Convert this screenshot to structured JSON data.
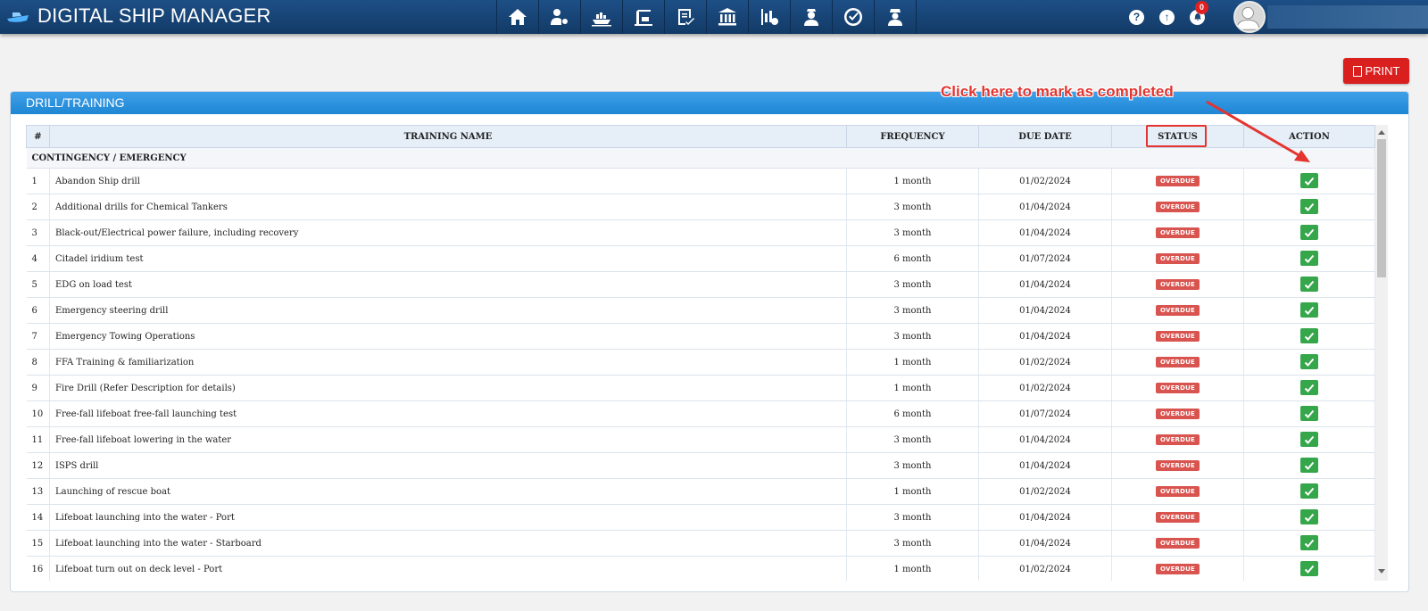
{
  "app": {
    "title": "DIGITAL SHIP MANAGER",
    "nav_icons": [
      "home-icon",
      "user-settings-icon",
      "ship-icon",
      "port-crane-icon",
      "certificate-icon",
      "bank-icon",
      "report-icon",
      "crew-icon",
      "checklist-icon",
      "officer-icon"
    ],
    "notification_count": "0",
    "help_glyph": "?",
    "upload_glyph": "↑"
  },
  "toolbar": {
    "print_label": "PRINT"
  },
  "panel": {
    "title": "DRILL/TRAINING",
    "annotation": "Click here to mark as completed"
  },
  "table": {
    "headers": {
      "index": "#",
      "name": "TRAINING NAME",
      "frequency": "FREQUENCY",
      "due_date": "DUE DATE",
      "status": "STATUS",
      "action": "ACTION"
    },
    "group": "CONTINGENCY / EMERGENCY",
    "rows": [
      {
        "n": "1",
        "name": "Abandon Ship drill",
        "freq": "1 month",
        "due": "01/02/2024",
        "status": "OVERDUE"
      },
      {
        "n": "2",
        "name": "Additional drills for Chemical Tankers",
        "freq": "3 month",
        "due": "01/04/2024",
        "status": "OVERDUE"
      },
      {
        "n": "3",
        "name": "Black-out/Electrical power failure, including recovery",
        "freq": "3 month",
        "due": "01/04/2024",
        "status": "OVERDUE"
      },
      {
        "n": "4",
        "name": "Citadel iridium test",
        "freq": "6 month",
        "due": "01/07/2024",
        "status": "OVERDUE"
      },
      {
        "n": "5",
        "name": "EDG on load test",
        "freq": "3 month",
        "due": "01/04/2024",
        "status": "OVERDUE"
      },
      {
        "n": "6",
        "name": "Emergency steering drill",
        "freq": "3 month",
        "due": "01/04/2024",
        "status": "OVERDUE"
      },
      {
        "n": "7",
        "name": "Emergency Towing Operations",
        "freq": "3 month",
        "due": "01/04/2024",
        "status": "OVERDUE"
      },
      {
        "n": "8",
        "name": "FFA Training & familiarization",
        "freq": "1 month",
        "due": "01/02/2024",
        "status": "OVERDUE"
      },
      {
        "n": "9",
        "name": "Fire Drill (Refer Description for details)",
        "freq": "1 month",
        "due": "01/02/2024",
        "status": "OVERDUE"
      },
      {
        "n": "10",
        "name": "Free-fall lifeboat free-fall launching test",
        "freq": "6 month",
        "due": "01/07/2024",
        "status": "OVERDUE"
      },
      {
        "n": "11",
        "name": "Free-fall lifeboat lowering in the water",
        "freq": "3 month",
        "due": "01/04/2024",
        "status": "OVERDUE"
      },
      {
        "n": "12",
        "name": "ISPS drill",
        "freq": "3 month",
        "due": "01/04/2024",
        "status": "OVERDUE"
      },
      {
        "n": "13",
        "name": "Launching of rescue boat",
        "freq": "1 month",
        "due": "01/02/2024",
        "status": "OVERDUE"
      },
      {
        "n": "14",
        "name": "Lifeboat launching into the water - Port",
        "freq": "3 month",
        "due": "01/04/2024",
        "status": "OVERDUE"
      },
      {
        "n": "15",
        "name": "Lifeboat launching into the water - Starboard",
        "freq": "3 month",
        "due": "01/04/2024",
        "status": "OVERDUE"
      },
      {
        "n": "16",
        "name": "Lifeboat turn out on deck level - Port",
        "freq": "1 month",
        "due": "01/02/2024",
        "status": "OVERDUE"
      }
    ]
  },
  "colors": {
    "header_bg": "#1a4878",
    "panel_head": "#2b93de",
    "overdue": "#d9534f",
    "action_green": "#35a64a",
    "annotation": "#e3342f"
  }
}
